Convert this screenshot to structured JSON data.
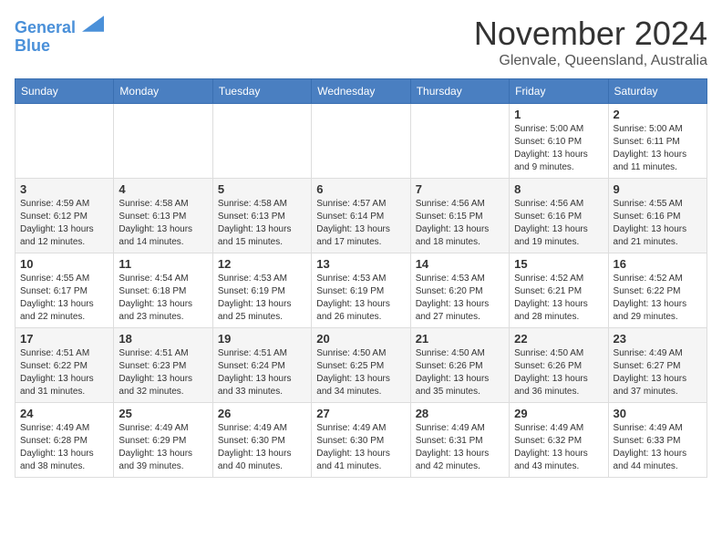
{
  "header": {
    "logo_line1": "General",
    "logo_line2": "Blue",
    "month_title": "November 2024",
    "location": "Glenvale, Queensland, Australia"
  },
  "weekdays": [
    "Sunday",
    "Monday",
    "Tuesday",
    "Wednesday",
    "Thursday",
    "Friday",
    "Saturday"
  ],
  "weeks": [
    [
      {
        "day": "",
        "info": ""
      },
      {
        "day": "",
        "info": ""
      },
      {
        "day": "",
        "info": ""
      },
      {
        "day": "",
        "info": ""
      },
      {
        "day": "",
        "info": ""
      },
      {
        "day": "1",
        "info": "Sunrise: 5:00 AM\nSunset: 6:10 PM\nDaylight: 13 hours\nand 9 minutes."
      },
      {
        "day": "2",
        "info": "Sunrise: 5:00 AM\nSunset: 6:11 PM\nDaylight: 13 hours\nand 11 minutes."
      }
    ],
    [
      {
        "day": "3",
        "info": "Sunrise: 4:59 AM\nSunset: 6:12 PM\nDaylight: 13 hours\nand 12 minutes."
      },
      {
        "day": "4",
        "info": "Sunrise: 4:58 AM\nSunset: 6:13 PM\nDaylight: 13 hours\nand 14 minutes."
      },
      {
        "day": "5",
        "info": "Sunrise: 4:58 AM\nSunset: 6:13 PM\nDaylight: 13 hours\nand 15 minutes."
      },
      {
        "day": "6",
        "info": "Sunrise: 4:57 AM\nSunset: 6:14 PM\nDaylight: 13 hours\nand 17 minutes."
      },
      {
        "day": "7",
        "info": "Sunrise: 4:56 AM\nSunset: 6:15 PM\nDaylight: 13 hours\nand 18 minutes."
      },
      {
        "day": "8",
        "info": "Sunrise: 4:56 AM\nSunset: 6:16 PM\nDaylight: 13 hours\nand 19 minutes."
      },
      {
        "day": "9",
        "info": "Sunrise: 4:55 AM\nSunset: 6:16 PM\nDaylight: 13 hours\nand 21 minutes."
      }
    ],
    [
      {
        "day": "10",
        "info": "Sunrise: 4:55 AM\nSunset: 6:17 PM\nDaylight: 13 hours\nand 22 minutes."
      },
      {
        "day": "11",
        "info": "Sunrise: 4:54 AM\nSunset: 6:18 PM\nDaylight: 13 hours\nand 23 minutes."
      },
      {
        "day": "12",
        "info": "Sunrise: 4:53 AM\nSunset: 6:19 PM\nDaylight: 13 hours\nand 25 minutes."
      },
      {
        "day": "13",
        "info": "Sunrise: 4:53 AM\nSunset: 6:19 PM\nDaylight: 13 hours\nand 26 minutes."
      },
      {
        "day": "14",
        "info": "Sunrise: 4:53 AM\nSunset: 6:20 PM\nDaylight: 13 hours\nand 27 minutes."
      },
      {
        "day": "15",
        "info": "Sunrise: 4:52 AM\nSunset: 6:21 PM\nDaylight: 13 hours\nand 28 minutes."
      },
      {
        "day": "16",
        "info": "Sunrise: 4:52 AM\nSunset: 6:22 PM\nDaylight: 13 hours\nand 29 minutes."
      }
    ],
    [
      {
        "day": "17",
        "info": "Sunrise: 4:51 AM\nSunset: 6:22 PM\nDaylight: 13 hours\nand 31 minutes."
      },
      {
        "day": "18",
        "info": "Sunrise: 4:51 AM\nSunset: 6:23 PM\nDaylight: 13 hours\nand 32 minutes."
      },
      {
        "day": "19",
        "info": "Sunrise: 4:51 AM\nSunset: 6:24 PM\nDaylight: 13 hours\nand 33 minutes."
      },
      {
        "day": "20",
        "info": "Sunrise: 4:50 AM\nSunset: 6:25 PM\nDaylight: 13 hours\nand 34 minutes."
      },
      {
        "day": "21",
        "info": "Sunrise: 4:50 AM\nSunset: 6:26 PM\nDaylight: 13 hours\nand 35 minutes."
      },
      {
        "day": "22",
        "info": "Sunrise: 4:50 AM\nSunset: 6:26 PM\nDaylight: 13 hours\nand 36 minutes."
      },
      {
        "day": "23",
        "info": "Sunrise: 4:49 AM\nSunset: 6:27 PM\nDaylight: 13 hours\nand 37 minutes."
      }
    ],
    [
      {
        "day": "24",
        "info": "Sunrise: 4:49 AM\nSunset: 6:28 PM\nDaylight: 13 hours\nand 38 minutes."
      },
      {
        "day": "25",
        "info": "Sunrise: 4:49 AM\nSunset: 6:29 PM\nDaylight: 13 hours\nand 39 minutes."
      },
      {
        "day": "26",
        "info": "Sunrise: 4:49 AM\nSunset: 6:30 PM\nDaylight: 13 hours\nand 40 minutes."
      },
      {
        "day": "27",
        "info": "Sunrise: 4:49 AM\nSunset: 6:30 PM\nDaylight: 13 hours\nand 41 minutes."
      },
      {
        "day": "28",
        "info": "Sunrise: 4:49 AM\nSunset: 6:31 PM\nDaylight: 13 hours\nand 42 minutes."
      },
      {
        "day": "29",
        "info": "Sunrise: 4:49 AM\nSunset: 6:32 PM\nDaylight: 13 hours\nand 43 minutes."
      },
      {
        "day": "30",
        "info": "Sunrise: 4:49 AM\nSunset: 6:33 PM\nDaylight: 13 hours\nand 44 minutes."
      }
    ]
  ]
}
